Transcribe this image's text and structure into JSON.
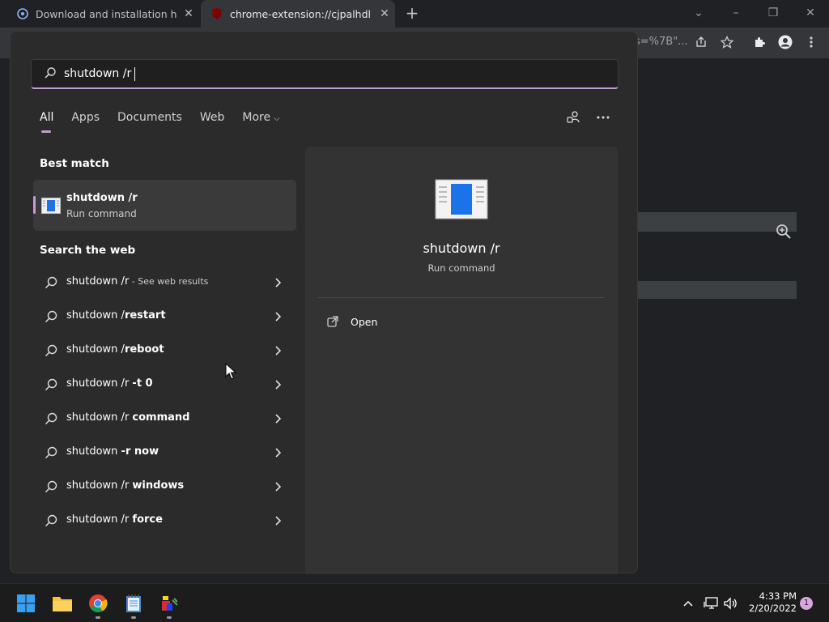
{
  "browser": {
    "tabs": [
      {
        "title": "Download and installation help"
      },
      {
        "title": "chrome-extension://cjpalhdlnbpafiamejdnhcphjbkeiagm"
      }
    ],
    "address_tail": "s=%7B\"..."
  },
  "search": {
    "query": "shutdown /r",
    "filters": [
      "All",
      "Apps",
      "Documents",
      "Web",
      "More"
    ],
    "best_match_title": "Best match",
    "best_match": {
      "title": "shutdown /r",
      "subtitle": "Run command"
    },
    "web_section_title": "Search the web",
    "web_results": [
      {
        "prefix": "shutdown /r",
        "bold": "",
        "sub": " - See web results"
      },
      {
        "prefix": "shutdown /",
        "bold": "restart",
        "sub": ""
      },
      {
        "prefix": "shutdown /",
        "bold": "reboot",
        "sub": ""
      },
      {
        "prefix": "shutdown /r ",
        "bold": "-t 0",
        "sub": ""
      },
      {
        "prefix": "shutdown /r ",
        "bold": "command",
        "sub": ""
      },
      {
        "prefix": "shutdown ",
        "bold": "-r now",
        "sub": ""
      },
      {
        "prefix": "shutdown /r ",
        "bold": "windows",
        "sub": ""
      },
      {
        "prefix": "shutdown /r ",
        "bold": "force",
        "sub": ""
      }
    ],
    "preview": {
      "title": "shutdown /r",
      "subtitle": "Run command",
      "open_label": "Open"
    }
  },
  "taskbar": {
    "time": "4:33 PM",
    "date": "2/20/2022",
    "notification_count": "1"
  },
  "colors": {
    "accent": "#c59ad8"
  }
}
